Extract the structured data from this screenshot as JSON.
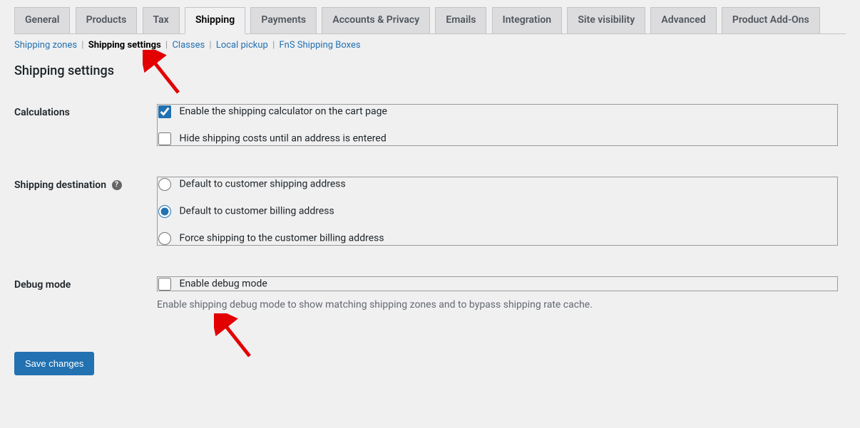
{
  "tabs": [
    {
      "label": "General",
      "active": false
    },
    {
      "label": "Products",
      "active": false
    },
    {
      "label": "Tax",
      "active": false
    },
    {
      "label": "Shipping",
      "active": true
    },
    {
      "label": "Payments",
      "active": false
    },
    {
      "label": "Accounts & Privacy",
      "active": false
    },
    {
      "label": "Emails",
      "active": false
    },
    {
      "label": "Integration",
      "active": false
    },
    {
      "label": "Site visibility",
      "active": false
    },
    {
      "label": "Advanced",
      "active": false
    },
    {
      "label": "Product Add-Ons",
      "active": false
    }
  ],
  "subnav": [
    {
      "label": "Shipping zones",
      "current": false
    },
    {
      "label": "Shipping settings",
      "current": true
    },
    {
      "label": "Classes",
      "current": false
    },
    {
      "label": "Local pickup",
      "current": false
    },
    {
      "label": "FnS Shipping Boxes",
      "current": false
    }
  ],
  "page_title": "Shipping settings",
  "sections": {
    "calculations": {
      "label": "Calculations",
      "options": {
        "enable_calculator": {
          "label": "Enable the shipping calculator on the cart page",
          "checked": true
        },
        "hide_costs": {
          "label": "Hide shipping costs until an address is entered",
          "checked": false
        }
      }
    },
    "destination": {
      "label": "Shipping destination",
      "options": {
        "shipping": {
          "label": "Default to customer shipping address",
          "selected": false
        },
        "billing": {
          "label": "Default to customer billing address",
          "selected": true
        },
        "force_billing": {
          "label": "Force shipping to the customer billing address",
          "selected": false
        }
      }
    },
    "debug": {
      "label": "Debug mode",
      "option": {
        "label": "Enable debug mode",
        "checked": false
      },
      "description": "Enable shipping debug mode to show matching shipping zones and to bypass shipping rate cache."
    }
  },
  "submit_label": "Save changes"
}
